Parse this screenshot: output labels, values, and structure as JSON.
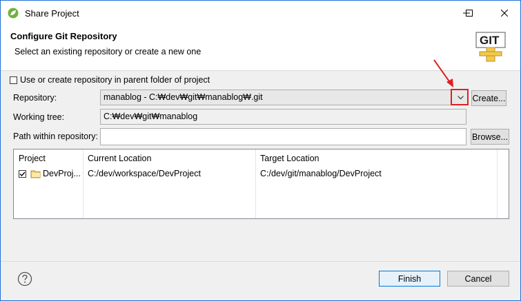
{
  "window": {
    "title": "Share Project"
  },
  "header": {
    "title": "Configure Git Repository",
    "subtitle": "Select an existing repository or create a new one",
    "logo_text": "GIT"
  },
  "options": {
    "use_parent_label": "Use or create repository in parent folder of project",
    "use_parent_checked": false
  },
  "repository": {
    "label": "Repository:",
    "value": "manablog - C:₩dev₩git₩manablog₩.git",
    "create_button": "Create..."
  },
  "working_tree": {
    "label": "Working tree:",
    "value": "C:₩dev₩git₩manablog"
  },
  "path": {
    "label": "Path within repository:",
    "value": "",
    "browse_button": "Browse..."
  },
  "table": {
    "headers": [
      "Project",
      "Current Location",
      "Target Location"
    ],
    "rows": [
      {
        "checked": true,
        "project": "DevProj...",
        "current": "C:/dev/workspace/DevProject",
        "target": "C:/dev/git/manablog/DevProject"
      }
    ]
  },
  "footer": {
    "finish_button": "Finish",
    "cancel_button": "Cancel"
  },
  "colors": {
    "accent_border": "#1f6fd6",
    "highlight_red": "#e02020"
  }
}
